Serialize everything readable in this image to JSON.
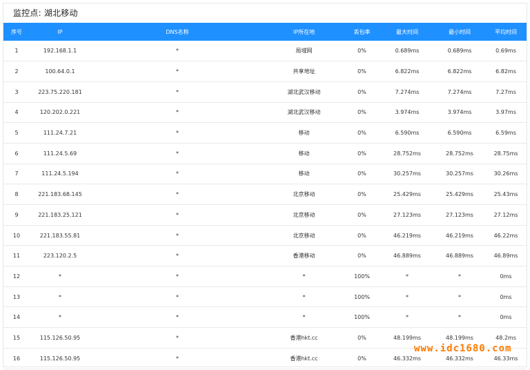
{
  "monitor": {
    "title": "监控点: 湖北移动"
  },
  "table": {
    "headers": [
      "序号",
      "IP",
      "DNS名称",
      "IP所在地",
      "丢包率",
      "最大时间",
      "最小时间",
      "平均时间"
    ],
    "rows": [
      [
        "1",
        "192.168.1.1",
        "*",
        "局域网",
        "0%",
        "0.689ms",
        "0.689ms",
        "0.69ms"
      ],
      [
        "2",
        "100.64.0.1",
        "*",
        "共享地址",
        "0%",
        "6.822ms",
        "6.822ms",
        "6.82ms"
      ],
      [
        "3",
        "223.75.220.181",
        "*",
        "湖北武汉移动",
        "0%",
        "7.274ms",
        "7.274ms",
        "7.27ms"
      ],
      [
        "4",
        "120.202.0.221",
        "*",
        "湖北武汉移动",
        "0%",
        "3.974ms",
        "3.974ms",
        "3.97ms"
      ],
      [
        "5",
        "111.24.7.21",
        "*",
        "移动",
        "0%",
        "6.590ms",
        "6.590ms",
        "6.59ms"
      ],
      [
        "6",
        "111.24.5.69",
        "*",
        "移动",
        "0%",
        "28.752ms",
        "28.752ms",
        "28.75ms"
      ],
      [
        "7",
        "111.24.5.194",
        "*",
        "移动",
        "0%",
        "30.257ms",
        "30.257ms",
        "30.26ms"
      ],
      [
        "8",
        "221.183.68.145",
        "*",
        "北京移动",
        "0%",
        "25.429ms",
        "25.429ms",
        "25.43ms"
      ],
      [
        "9",
        "221.183.25.121",
        "*",
        "北京移动",
        "0%",
        "27.123ms",
        "27.123ms",
        "27.12ms"
      ],
      [
        "10",
        "221.183.55.81",
        "*",
        "北京移动",
        "0%",
        "46.219ms",
        "46.219ms",
        "46.22ms"
      ],
      [
        "11",
        "223.120.2.5",
        "*",
        "香港移动",
        "0%",
        "46.889ms",
        "46.889ms",
        "46.89ms"
      ],
      [
        "12",
        "*",
        "*",
        "*",
        "100%",
        "*",
        "*",
        "0ms"
      ],
      [
        "13",
        "*",
        "*",
        "*",
        "100%",
        "*",
        "*",
        "0ms"
      ],
      [
        "14",
        "*",
        "*",
        "*",
        "100%",
        "*",
        "*",
        "0ms"
      ],
      [
        "15",
        "115.126.50.95",
        "*",
        "香港hkt.cc",
        "0%",
        "48.199ms",
        "48.199ms",
        "48.2ms"
      ],
      [
        "16",
        "115.126.50.95",
        "*",
        "香港hkt.cc",
        "0%",
        "46.332ms",
        "46.332ms",
        "46.33ms"
      ]
    ]
  },
  "watermark": {
    "text": "www.idc1680.com"
  },
  "colors": {
    "header_bg": "#1e90ff",
    "watermark": "#ff7a00"
  }
}
